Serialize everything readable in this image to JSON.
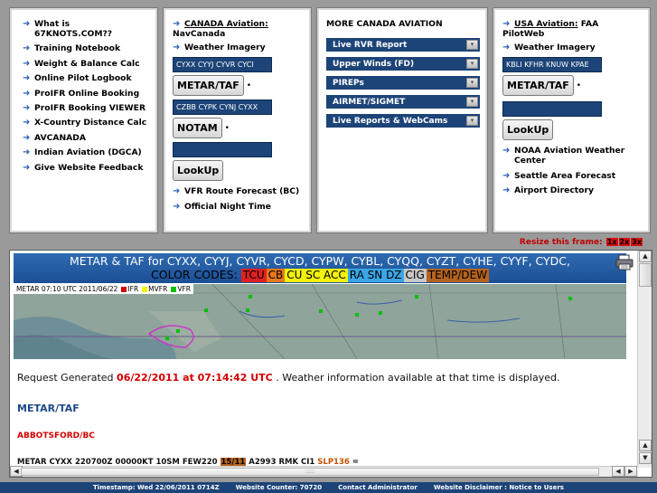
{
  "panel1": {
    "links": [
      "What is 67KNOTS.COM??",
      "Training Notebook",
      "Weight & Balance Calc",
      "Online Pilot Logbook",
      "ProIFR Online Booking",
      "ProIFR Booking VIEWER",
      "X-Country Distance Calc",
      "AVCANADA",
      "Indian Aviation (DGCA)",
      "Give Website Feedback"
    ]
  },
  "panel2": {
    "title_link": "CANADA Aviation:",
    "title_sub": "NavCanada",
    "weather_imagery": "Weather Imagery",
    "metar_input_value": "CYXX CYYJ CYVR CYCI",
    "metar_button": "METAR/TAF",
    "notam_input_value": "CZBB CYPK CYNJ CYXX",
    "notam_button": "NOTAM",
    "lookup_input_value": "",
    "lookup_button": "LookUp",
    "vfr_route": "VFR Route Forecast (BC)",
    "night_time": "Official Night Time"
  },
  "panel3": {
    "title": "MORE CANADA AVIATION",
    "selects": [
      "Live RVR Report",
      "Upper Winds (FD)",
      "PIREPs",
      "AIRMET/SIGMET",
      "Live Reports & WebCams"
    ]
  },
  "panel4": {
    "title_link": "USA Aviation:",
    "title_rest": " FAA",
    "title_sub": "PilotWeb",
    "weather_imagery": "Weather Imagery",
    "metar_input_value": "KBLI KFHR KNUW KPAE",
    "metar_button": "METAR/TAF",
    "lookup_input_value": "",
    "lookup_button": "LookUp",
    "noaa_line1": "NOAA Aviation Weather",
    "noaa_line2": "Center",
    "seattle": "Seattle Area Forecast",
    "airport_dir": "Airport Directory"
  },
  "resize": {
    "label": "Resize this frame:",
    "buttons": [
      "1x",
      "2x",
      "3x"
    ]
  },
  "report": {
    "banner_line1": "METAR & TAF for CYXX, CYYJ, CYVR, CYCD, CYPW, CYBL, CYQQ, CYZT, CYHE, CYYF, CYDC,",
    "color_codes_label": "COLOR CODES:",
    "codes": [
      {
        "text": "TCU",
        "bg": "#e02020"
      },
      {
        "text": "CB",
        "bg": "#e8781a"
      },
      {
        "text": "CU SC ACC",
        "bg": "#f2f20a"
      },
      {
        "text": "RA SN DZ",
        "bg": "#3aa6e6"
      },
      {
        "text": "CIG",
        "bg": "#c9c9c9"
      },
      {
        "text": "TEMP/DEW",
        "bg": "#b5631f"
      }
    ],
    "map_timestamp": "METAR 07:10 UTC 2011/06/22",
    "map_legend": [
      {
        "label": "IFR",
        "color": "#d00000"
      },
      {
        "label": "MVFR",
        "color": "#f5f500"
      },
      {
        "label": "VFR",
        "color": "#00c000"
      }
    ],
    "request_prefix": "Request Generated ",
    "request_date": "06/22/2011 at 07:14:42 UTC",
    "request_suffix": " . Weather information available at that time is displayed.",
    "section_heading": "METAR/TAF",
    "station_name": "ABBOTSFORD/BC",
    "metar_prefix": "METAR CYXX 220700Z 00000KT 10SM FEW220 ",
    "metar_temp": "15/11",
    "metar_mid": " A2993 RMK CI1 ",
    "metar_slp": "SLP136",
    "metar_end": " ="
  },
  "footer": {
    "timestamp": "Timestamp: Wed 22/06/2011 0714Z",
    "counter": "Website Counter: 70720",
    "contact": "Contact Administrator",
    "disclaimer": "Website Disclaimer : Notice to Users"
  },
  "icons": {
    "arrow": "right-arrow-icon",
    "dropdown": "chevron-down-icon",
    "print": "printer-icon"
  }
}
